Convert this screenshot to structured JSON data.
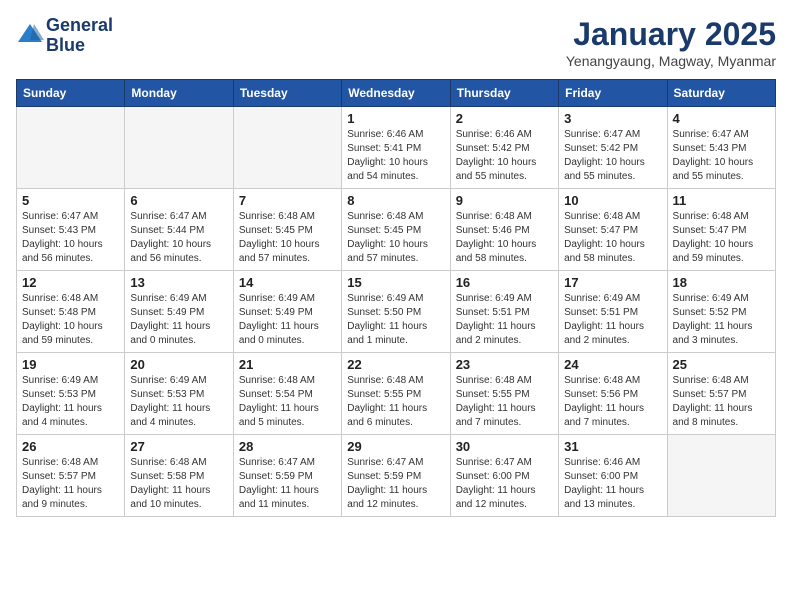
{
  "header": {
    "logo_line1": "General",
    "logo_line2": "Blue",
    "month_title": "January 2025",
    "subtitle": "Yenangyaung, Magway, Myanmar"
  },
  "days_of_week": [
    "Sunday",
    "Monday",
    "Tuesday",
    "Wednesday",
    "Thursday",
    "Friday",
    "Saturday"
  ],
  "weeks": [
    [
      {
        "day": "",
        "info": ""
      },
      {
        "day": "",
        "info": ""
      },
      {
        "day": "",
        "info": ""
      },
      {
        "day": "1",
        "info": "Sunrise: 6:46 AM\nSunset: 5:41 PM\nDaylight: 10 hours and 54 minutes."
      },
      {
        "day": "2",
        "info": "Sunrise: 6:46 AM\nSunset: 5:42 PM\nDaylight: 10 hours and 55 minutes."
      },
      {
        "day": "3",
        "info": "Sunrise: 6:47 AM\nSunset: 5:42 PM\nDaylight: 10 hours and 55 minutes."
      },
      {
        "day": "4",
        "info": "Sunrise: 6:47 AM\nSunset: 5:43 PM\nDaylight: 10 hours and 55 minutes."
      }
    ],
    [
      {
        "day": "5",
        "info": "Sunrise: 6:47 AM\nSunset: 5:43 PM\nDaylight: 10 hours and 56 minutes."
      },
      {
        "day": "6",
        "info": "Sunrise: 6:47 AM\nSunset: 5:44 PM\nDaylight: 10 hours and 56 minutes."
      },
      {
        "day": "7",
        "info": "Sunrise: 6:48 AM\nSunset: 5:45 PM\nDaylight: 10 hours and 57 minutes."
      },
      {
        "day": "8",
        "info": "Sunrise: 6:48 AM\nSunset: 5:45 PM\nDaylight: 10 hours and 57 minutes."
      },
      {
        "day": "9",
        "info": "Sunrise: 6:48 AM\nSunset: 5:46 PM\nDaylight: 10 hours and 58 minutes."
      },
      {
        "day": "10",
        "info": "Sunrise: 6:48 AM\nSunset: 5:47 PM\nDaylight: 10 hours and 58 minutes."
      },
      {
        "day": "11",
        "info": "Sunrise: 6:48 AM\nSunset: 5:47 PM\nDaylight: 10 hours and 59 minutes."
      }
    ],
    [
      {
        "day": "12",
        "info": "Sunrise: 6:48 AM\nSunset: 5:48 PM\nDaylight: 10 hours and 59 minutes."
      },
      {
        "day": "13",
        "info": "Sunrise: 6:49 AM\nSunset: 5:49 PM\nDaylight: 11 hours and 0 minutes."
      },
      {
        "day": "14",
        "info": "Sunrise: 6:49 AM\nSunset: 5:49 PM\nDaylight: 11 hours and 0 minutes."
      },
      {
        "day": "15",
        "info": "Sunrise: 6:49 AM\nSunset: 5:50 PM\nDaylight: 11 hours and 1 minute."
      },
      {
        "day": "16",
        "info": "Sunrise: 6:49 AM\nSunset: 5:51 PM\nDaylight: 11 hours and 2 minutes."
      },
      {
        "day": "17",
        "info": "Sunrise: 6:49 AM\nSunset: 5:51 PM\nDaylight: 11 hours and 2 minutes."
      },
      {
        "day": "18",
        "info": "Sunrise: 6:49 AM\nSunset: 5:52 PM\nDaylight: 11 hours and 3 minutes."
      }
    ],
    [
      {
        "day": "19",
        "info": "Sunrise: 6:49 AM\nSunset: 5:53 PM\nDaylight: 11 hours and 4 minutes."
      },
      {
        "day": "20",
        "info": "Sunrise: 6:49 AM\nSunset: 5:53 PM\nDaylight: 11 hours and 4 minutes."
      },
      {
        "day": "21",
        "info": "Sunrise: 6:48 AM\nSunset: 5:54 PM\nDaylight: 11 hours and 5 minutes."
      },
      {
        "day": "22",
        "info": "Sunrise: 6:48 AM\nSunset: 5:55 PM\nDaylight: 11 hours and 6 minutes."
      },
      {
        "day": "23",
        "info": "Sunrise: 6:48 AM\nSunset: 5:55 PM\nDaylight: 11 hours and 7 minutes."
      },
      {
        "day": "24",
        "info": "Sunrise: 6:48 AM\nSunset: 5:56 PM\nDaylight: 11 hours and 7 minutes."
      },
      {
        "day": "25",
        "info": "Sunrise: 6:48 AM\nSunset: 5:57 PM\nDaylight: 11 hours and 8 minutes."
      }
    ],
    [
      {
        "day": "26",
        "info": "Sunrise: 6:48 AM\nSunset: 5:57 PM\nDaylight: 11 hours and 9 minutes."
      },
      {
        "day": "27",
        "info": "Sunrise: 6:48 AM\nSunset: 5:58 PM\nDaylight: 11 hours and 10 minutes."
      },
      {
        "day": "28",
        "info": "Sunrise: 6:47 AM\nSunset: 5:59 PM\nDaylight: 11 hours and 11 minutes."
      },
      {
        "day": "29",
        "info": "Sunrise: 6:47 AM\nSunset: 5:59 PM\nDaylight: 11 hours and 12 minutes."
      },
      {
        "day": "30",
        "info": "Sunrise: 6:47 AM\nSunset: 6:00 PM\nDaylight: 11 hours and 12 minutes."
      },
      {
        "day": "31",
        "info": "Sunrise: 6:46 AM\nSunset: 6:00 PM\nDaylight: 11 hours and 13 minutes."
      },
      {
        "day": "",
        "info": ""
      }
    ]
  ]
}
